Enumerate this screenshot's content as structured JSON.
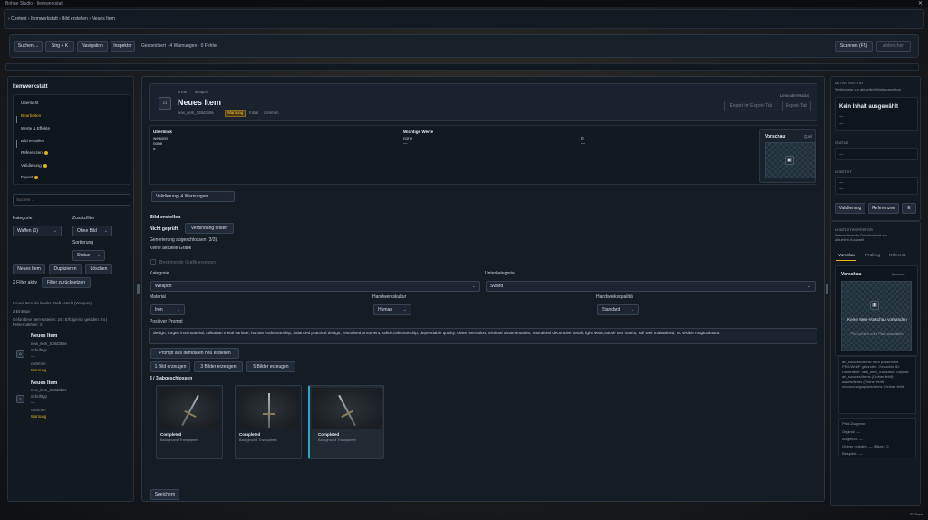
{
  "window": {
    "title": "Bohne Studio - Itemwerkstatt",
    "close": "✕",
    "version": "© Oben"
  },
  "breadcrumb": "› Content › Itemwerkstatt › Bild erstellen › Neues Item",
  "toolbar": {
    "search": "Suchen ...",
    "shortcut": "Strg + K",
    "navigation": "Navigation",
    "inspector": "Inspektor",
    "status": "Gespeichert · 4 Warnungen · 0 Fehler",
    "scan": "Scannen (F5)",
    "cancel": "Abbrechen"
  },
  "sidebar": {
    "title": "Itemwerkstatt",
    "nav": [
      {
        "label": "Übersicht",
        "dot": false
      },
      {
        "label": "Bearbeiten",
        "dot": false
      },
      {
        "label": "Werte & Effekte",
        "dot": false
      },
      {
        "label": "Bild erstellen",
        "dot": false
      },
      {
        "label": "Referenzen",
        "dot": true
      },
      {
        "label": "Validierung",
        "dot": true
      },
      {
        "label": "Export",
        "dot": true
      }
    ],
    "search_placeholder": "Suchen ...",
    "category_label": "Kategorie",
    "category_value": "Waffen (1)",
    "filter_label": "Zusatzfilter",
    "filter_value": "Ohne Bild",
    "sort_label": "Sortierung",
    "sort_value": "Status",
    "btn_new": "Neues Item",
    "btn_dup": "Duplizieren",
    "btn_del": "Löschen",
    "filter_count": "2 Filter aktiv",
    "btn_reset": "Filter zurücksetzen",
    "info1": "Neues Item als lokaler Draft erstellt (Weapon).",
    "info2": "2 Einträge",
    "info3": "Gefundene Item-Dateien: 24 | Erfolgreich geladen: 24 | Fehlerhaft/leer: 0",
    "items": [
      {
        "name": "Neues Item",
        "id": "new_item_038d3b8e",
        "kind": "Schrifttyp",
        "dash": "—",
        "rarity": "common",
        "status": "Warnung"
      },
      {
        "name": "Neues Item",
        "id": "new_item_038d3b8e",
        "kind": "Schrifttyp",
        "dash": "—",
        "rarity": "common",
        "status": "Warnung"
      }
    ]
  },
  "header": {
    "type": "ITEM",
    "category": "weapon",
    "title": "Neues Item",
    "id": "new_item_038d3b8e",
    "badge": "Warnung",
    "tag1": "Initial",
    "tag2": "common",
    "mode": "Leseoder Modus",
    "btn_export": "Export im Export-Tab",
    "btn_tab": "Export-Tab"
  },
  "overview": {
    "col1_title": "Überblick",
    "col1_lines": [
      "weapon",
      "none",
      "0"
    ],
    "col2_title": "Wichtige Werte",
    "col2_lines": [
      "none",
      "—"
    ],
    "col3_lines": [
      "0",
      "—"
    ],
    "preview_label": "Vorschau",
    "preview_hint": "Quel"
  },
  "validation_select": "Validierung: 4 Warnungen",
  "generate": {
    "section": "Bild erstellen",
    "status": "Nicht geprüft",
    "btn_test": "Verbindung testen",
    "line1": "Generierung abgeschlossen (3/3).",
    "line2": "Keine aktuelle Grafik",
    "checkbox": "Bestehende Grafik ersetzen",
    "category_label": "Kategorie",
    "category_value": "Weapon",
    "subcategory_label": "Unterkategorie",
    "subcategory_value": "Sword",
    "material_label": "Material",
    "material_value": "Iron",
    "culture_label": "Handwerkskultur",
    "culture_value": "Human",
    "quality_label": "Handwerksqualität",
    "quality_value": "Standard",
    "prompt_label": "Positiver Prompt",
    "prompt_text": "design, forged iron material, utilitarian metal surface, human craftsmanship, balanced practical design, restrained ornament, solid craftsmanship, dependable quality, clean execution, minimal ornamentation, restrained decorative detail, light wear, subtle use marks, still well maintained, no visible magical aura",
    "btn_rebuild": "Prompt aus Itemdaten neu erstellen",
    "btn_1": "1 Bild erzeugen",
    "btn_3": "3 Bilder erzeugen",
    "btn_5": "5 Bilder erzeugen",
    "result_count": "3 / 3 abgeschlossen",
    "results": [
      {
        "status": "Completed",
        "desc": "Background Transparent"
      },
      {
        "status": "Completed",
        "desc": "Background Transparent"
      },
      {
        "status": "Completed",
        "desc": "Background Transparent"
      }
    ],
    "btn_save": "Speichern"
  },
  "inspector": {
    "active_title": "AKTIVE ENTITÄT",
    "active_sub": "Verbindung zur aktuellen Workspace Aus",
    "empty": "Kein Inhalt ausgewählt",
    "dash": "—",
    "status_title": "STATUS",
    "context_title": "KONTEXT",
    "btn_validate": "Validierung",
    "btn_refs": "Referenzen",
    "btn_e": "E",
    "context_panel_title": "KONTEXTINSPEKTOR",
    "context_panel_sub": "Unterstützende Detailansicht zur aktuellen Auswahl",
    "tabs": [
      "Vorschau",
      "Prüfung",
      "Referenz"
    ],
    "preview_title": "Vorschau",
    "preview_tag": "Quadrat",
    "no_preview": "Keine Item-Vorschau vorhanden",
    "no_preview_hint": "Pfad prüfen oder Pfad auswählen",
    "path_info": "art_sources/items/ Kein passendes PNG/WebP gefunden. Gesuchte ID: Dateiname: new_item_038d3b8e Geprüft: art_sources/items (Ordner fehlt) · assets/items (Ordner fehlt) · resources/graphics/items (Ordner fehlt)",
    "diag_title": "Pfad-Diagnose",
    "diag_lines": [
      "Original: —",
      "Aufgelöst: —",
      "Ordner existiert: —   |   Bilder: 0",
      "Beispiele: —"
    ]
  }
}
